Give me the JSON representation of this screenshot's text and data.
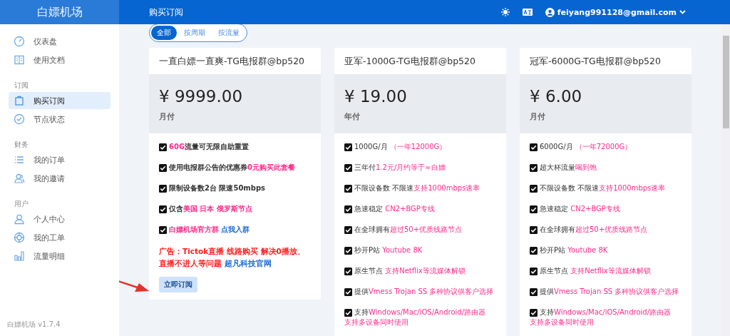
{
  "sidebar": {
    "brand": "白嫖机场",
    "sections": [
      {
        "items": [
          {
            "label": "仪表盘",
            "selected": false
          },
          {
            "label": "使用文档",
            "selected": false
          }
        ]
      },
      {
        "heading": "订阅",
        "items": [
          {
            "label": "购买订阅",
            "selected": true
          },
          {
            "label": "节点状态",
            "selected": false
          }
        ]
      },
      {
        "heading": "财务",
        "items": [
          {
            "label": "我的订单",
            "selected": false
          },
          {
            "label": "我的邀请",
            "selected": false
          }
        ]
      },
      {
        "heading": "用户",
        "items": [
          {
            "label": "个人中心",
            "selected": false
          },
          {
            "label": "我的工单",
            "selected": false
          },
          {
            "label": "流量明细",
            "selected": false
          }
        ]
      }
    ],
    "version": "白嫖机场 v1.7.4"
  },
  "header": {
    "title": "购买订阅",
    "email": "feiyang991128@gmail.com"
  },
  "filters": [
    {
      "label": "全部",
      "selected": true
    },
    {
      "label": "按周期",
      "selected": false
    },
    {
      "label": "按流量",
      "selected": false
    }
  ],
  "cards": [
    {
      "title": "一直白嫖一直爽-TG电报群@bp520",
      "price": "¥ 9999.00",
      "period": "月付",
      "bold": true,
      "features": [
        [
          {
            "text": "60G",
            "kind": "highlight"
          },
          {
            "text": "流量可无限自助重置",
            "kind": "plain"
          }
        ],
        [
          {
            "text": "使用电报群公告的优惠券",
            "kind": "plain"
          },
          {
            "text": "0元购买此套餐",
            "kind": "highlight"
          }
        ],
        [
          {
            "text": "限制设备数2台 限速50mbps",
            "kind": "plain"
          }
        ],
        [
          {
            "text": "仅含",
            "kind": "plain"
          },
          {
            "text": "美国 日本 俄罗斯节点",
            "kind": "highlight"
          }
        ],
        [
          {
            "text": "白嫖机场官方群 ",
            "kind": "highlight"
          },
          {
            "text": "点我入群",
            "kind": "link"
          }
        ]
      ],
      "note": [
        {
          "text": "广告：Tictok直播 线路购买 解决0播放、直播不进人等问题 ",
          "kind": "alert"
        },
        {
          "text": "超凡科技官网",
          "kind": "link"
        }
      ],
      "button": "立即订阅"
    },
    {
      "title": "亚军-1000G-TG电报群@bp520",
      "price": "¥ 19.00",
      "period": "年付",
      "bold": false,
      "features": [
        [
          {
            "text": "1000G/月 ",
            "kind": "plain"
          },
          {
            "text": "（一年12000G）",
            "kind": "highlight"
          }
        ],
        [
          {
            "text": "三年付",
            "kind": "plain"
          },
          {
            "text": "1.2元/月约等于≈白嫖",
            "kind": "highlight"
          }
        ],
        [
          {
            "text": "不限设备数 不限速",
            "kind": "plain"
          },
          {
            "text": "支持1000mbps速率",
            "kind": "highlight"
          }
        ],
        [
          {
            "text": "急速稳定 ",
            "kind": "plain"
          },
          {
            "text": "CN2+BGP专线",
            "kind": "highlight"
          }
        ],
        [
          {
            "text": "在全球拥有",
            "kind": "plain"
          },
          {
            "text": "超过50+优质线路节点",
            "kind": "highlight"
          }
        ],
        [
          {
            "text": "秒开P站 ",
            "kind": "plain"
          },
          {
            "text": "Youtube 8K",
            "kind": "highlight"
          }
        ],
        [
          {
            "text": "原生节点 ",
            "kind": "plain"
          },
          {
            "text": "支持Netflix等流媒体解锁",
            "kind": "highlight"
          }
        ],
        [
          {
            "text": "提供",
            "kind": "plain"
          },
          {
            "text": "Vmess Trojan SS 多种协议供客户选择",
            "kind": "highlight"
          }
        ],
        [
          {
            "text": "支持",
            "kind": "plain"
          },
          {
            "text": "Windows/Mac/iOS/Android/路由器",
            "kind": "highlight"
          },
          {
            "text": "支持多设备同时使用",
            "kind": "wrapped"
          }
        ]
      ]
    },
    {
      "title": "冠军-6000G-TG电报群@bp520",
      "price": "¥ 6.00",
      "period": "月付",
      "bold": false,
      "features": [
        [
          {
            "text": "6000G/月 ",
            "kind": "plain"
          },
          {
            "text": "（一年72000G）",
            "kind": "highlight"
          }
        ],
        [
          {
            "text": "超大杯流量",
            "kind": "plain"
          },
          {
            "text": "喝到饱",
            "kind": "highlight"
          }
        ],
        [
          {
            "text": "不限设备数 不限速",
            "kind": "plain"
          },
          {
            "text": "支持1000mbps速率",
            "kind": "highlight"
          }
        ],
        [
          {
            "text": "急速稳定 ",
            "kind": "plain"
          },
          {
            "text": "CN2+BGP专线",
            "kind": "highlight"
          }
        ],
        [
          {
            "text": "在全球拥有",
            "kind": "plain"
          },
          {
            "text": "超过50+优质线路节点",
            "kind": "highlight"
          }
        ],
        [
          {
            "text": "秒开P站 ",
            "kind": "plain"
          },
          {
            "text": "Youtube 8K",
            "kind": "highlight"
          }
        ],
        [
          {
            "text": "原生节点 ",
            "kind": "plain"
          },
          {
            "text": "支持Netflix等流媒体解锁",
            "kind": "highlight"
          }
        ],
        [
          {
            "text": "提供",
            "kind": "plain"
          },
          {
            "text": "Vmess Trojan SS 多种协议供客户选择",
            "kind": "highlight"
          }
        ],
        [
          {
            "text": "支持",
            "kind": "plain"
          },
          {
            "text": "Windows/Mac/iOS/Android/路由器",
            "kind": "highlight"
          },
          {
            "text": "支持多设备同时使用",
            "kind": "wrapped"
          }
        ]
      ]
    }
  ]
}
